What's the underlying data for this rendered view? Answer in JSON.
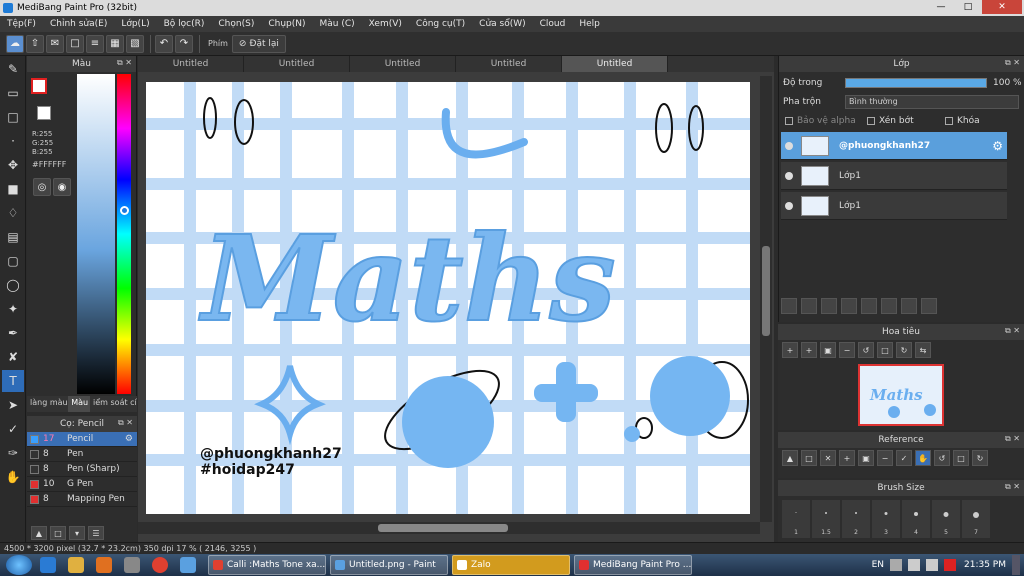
{
  "window": {
    "title": "MediBang Paint Pro (32bit)"
  },
  "menu": [
    "Tệp(F)",
    "Chỉnh sửa(E)",
    "Lớp(L)",
    "Bộ lọc(R)",
    "Chọn(S)",
    "Chụp(N)",
    "Màu (C)",
    "Xem(V)",
    "Công cụ(T)",
    "Cửa sổ(W)",
    "Cloud",
    "Help"
  ],
  "toolbar": {
    "phim_label": "Phím",
    "reset_label": "Đặt lại"
  },
  "color_panel": {
    "title": "Màu",
    "rgb": [
      "R:255",
      "G:255",
      "B:255"
    ],
    "hex": "#FFFFFF",
    "tabs": [
      "làng màu",
      "Màu",
      "iểm soát cí"
    ],
    "colors": {
      "primary": "#ffffff",
      "accent": "#2e6cb8"
    }
  },
  "brush_panel": {
    "title": "Cọ: Pencil",
    "items": [
      {
        "size": "17",
        "name": "Pencil",
        "chip": "#3aa0ff"
      },
      {
        "size": "8",
        "name": "Pen",
        "chip": "#333333"
      },
      {
        "size": "8",
        "name": "Pen (Sharp)",
        "chip": "#333333"
      },
      {
        "size": "10",
        "name": "G Pen",
        "chip": "#e03030"
      },
      {
        "size": "8",
        "name": "Mapping Pen",
        "chip": "#e03030"
      }
    ]
  },
  "doc_tabs": [
    "Untitled",
    "Untitled",
    "Untitled",
    "Untitled",
    "Untitled"
  ],
  "canvas": {
    "title_text": "Maths",
    "watermark": [
      "@phuongkhanh27",
      "#hoidap247"
    ]
  },
  "layer_panel": {
    "title": "Lớp",
    "opacity_label": "Độ trong",
    "opacity_value": "100 %",
    "blend_label": "Pha trộn",
    "blend_value": "Bình thường",
    "protect_alpha": "Bảo vệ alpha",
    "clipping": "Xén bớt",
    "lock": "Khóa",
    "layers": [
      {
        "name": "@phuongkhanh27",
        "selected": true
      },
      {
        "name": "Lớp1",
        "selected": false
      },
      {
        "name": "Lớp1",
        "selected": false
      }
    ]
  },
  "navigator": {
    "title": "Hoa tiêu"
  },
  "reference": {
    "title": "Reference"
  },
  "brush_size": {
    "title": "Brush Size",
    "sizes": [
      "1",
      "1.5",
      "2",
      "3",
      "4",
      "5",
      "7"
    ]
  },
  "status": "4500 * 3200 pixel   (32.7 * 23.2cm)   350 dpi   17 %   ( 2146, 3255 )",
  "taskbar": {
    "tasks": [
      "Calli :Maths Tone xa...",
      "Untitled.png - Paint",
      "Zalo",
      "MediBang Paint Pro ..."
    ],
    "lang": "EN",
    "time": "21:35 PM"
  }
}
